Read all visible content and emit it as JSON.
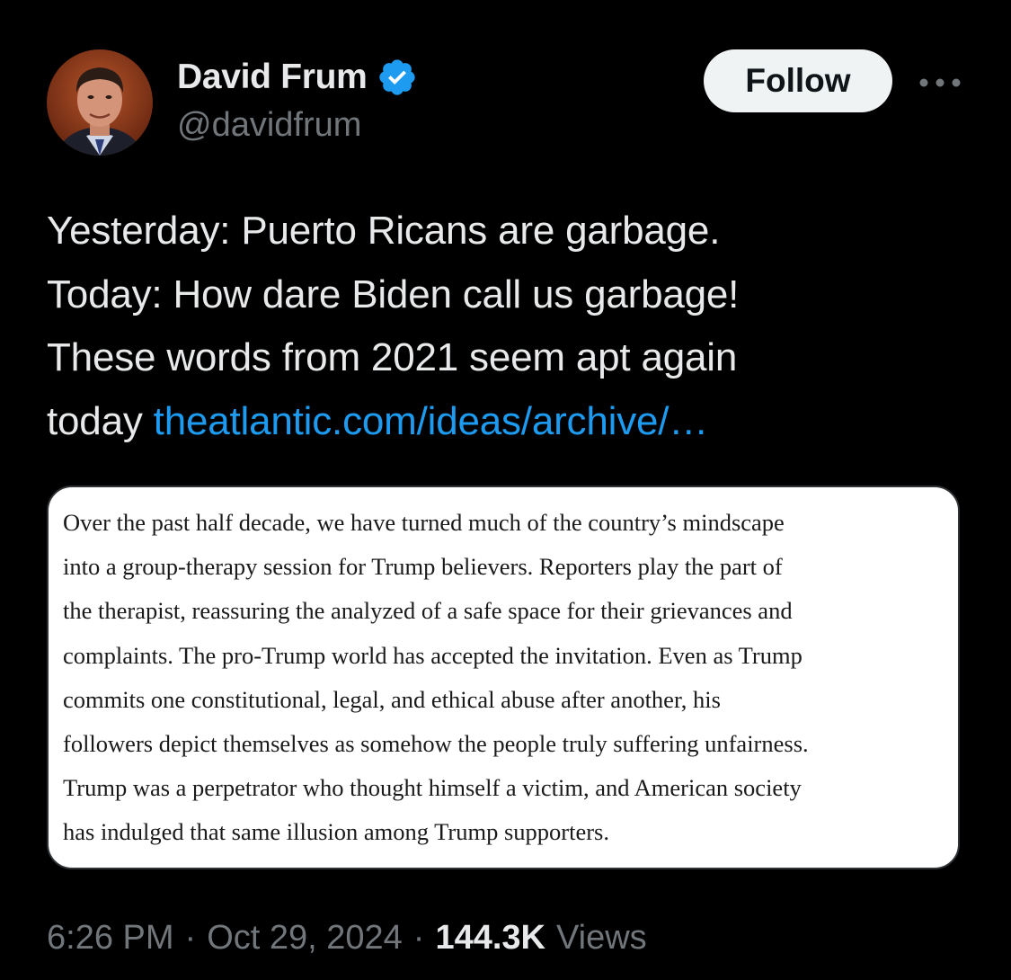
{
  "author": {
    "display_name": "David Frum",
    "handle": "@davidfrum",
    "verified": true,
    "avatar_icon": "profile-photo"
  },
  "actions": {
    "follow_label": "Follow",
    "more_icon": "more-horizontal-icon"
  },
  "tweet": {
    "lines": [
      "Yesterday: Puerto Ricans are garbage.",
      "Today: How dare Biden call us garbage!",
      "These words from 2021 seem apt again"
    ],
    "last_line_prefix": "today ",
    "link_text": "theatlantic.com/ideas/archive/…"
  },
  "quote_image": {
    "lines": [
      "Over the past half decade, we have turned much of the country’s mindscape",
      "into a group-therapy session for Trump believers. Reporters play the part of",
      "the therapist, reassuring the analyzed of a safe space for their grievances and",
      "complaints. The pro-Trump world has accepted the invitation. Even as Trump",
      "commits one constitutional, legal, and ethical abuse after another, his",
      "followers depict themselves as somehow the people truly suffering unfairness.",
      "Trump was a perpetrator who thought himself a victim, and American society",
      "has indulged that same illusion among Trump supporters."
    ]
  },
  "meta": {
    "time": "6:26 PM",
    "separator": "·",
    "date": "Oct 29, 2024",
    "views_count": "144.3K",
    "views_label": "Views"
  },
  "colors": {
    "background": "#000000",
    "text_primary": "#e7e9ea",
    "text_secondary": "#71767b",
    "link": "#1d9bf0",
    "verified": "#1d9bf0",
    "follow_bg": "#eff3f4"
  }
}
